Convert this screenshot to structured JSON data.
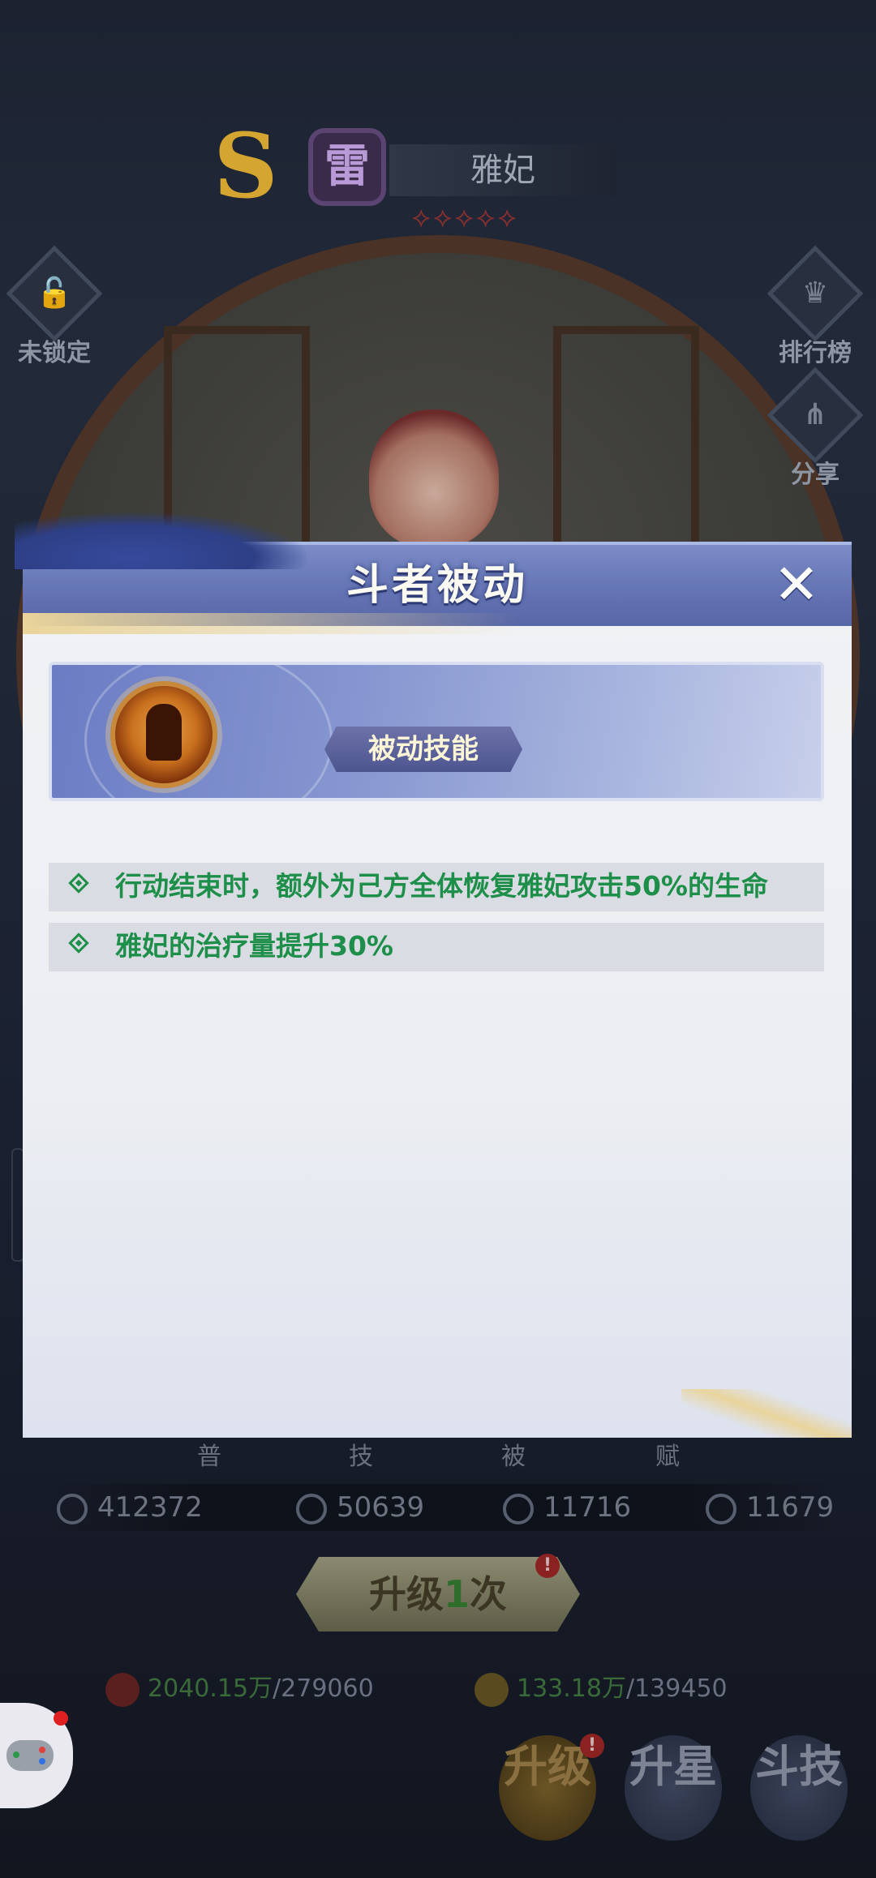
{
  "background": {
    "rank": "S",
    "element": "雷",
    "hero_name": "雅妃",
    "stars": "⟡⟡⟡⟡⟡",
    "left_button": "未锁定",
    "right_buttons": [
      "排行榜",
      "分享"
    ],
    "skill_tabs": [
      "普",
      "技",
      "被",
      "赋"
    ],
    "stats": [
      "412372",
      "50639",
      "11716",
      "11679"
    ],
    "upgrade_button": {
      "prefix": "升级",
      "count": "1",
      "suffix": "次",
      "badge": "!"
    },
    "resources": [
      {
        "value": "2040.15万",
        "need": "/279060"
      },
      {
        "value": "133.18万",
        "need": "/139450"
      }
    ],
    "bottom_nav": [
      {
        "label": "升级",
        "badge": "!"
      },
      {
        "label": "升星"
      },
      {
        "label": "斗技"
      }
    ]
  },
  "modal": {
    "title": "斗者被动",
    "close_icon": "close-icon",
    "skill_type": "被动技能",
    "descriptions": [
      "行动结束时，额外为己方全体恢复雅妃攻击50%的生命",
      "雅妃的治疗量提升30%"
    ]
  },
  "colors": {
    "header_blue": "#6474b4",
    "desc_green": "#1e8f4a",
    "panel_bg": "#eceef2",
    "desc_row_bg": "#d9dce2"
  }
}
